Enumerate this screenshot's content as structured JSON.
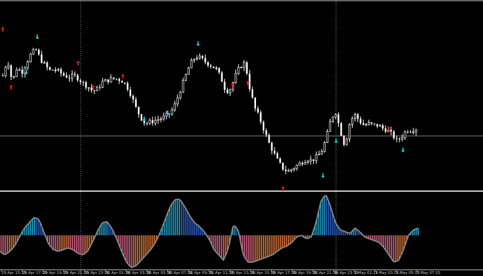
{
  "chart_data": {
    "type": "candlestick",
    "colors": {
      "background": "#000000",
      "candle_up": "#ffffff",
      "candle_down": "#ffffff",
      "wick": "#ffffff",
      "separator": "#c8c8c8",
      "grid_dotted": "#9a9a9a",
      "hline": "#808080",
      "buy_arrow": "#00e5ee",
      "sell_arrow": "#ff1a1a",
      "hist_pos": "#1ea7d6",
      "hist_pos_alt": "#2f63c8",
      "hist_neg": "#d9668a",
      "hist_neg_alt": "#e07a3a",
      "osc_line": "#8a8a8a"
    },
    "price_trace": [
      0.7,
      0.8,
      0.66,
      0.75,
      0.72,
      0.78,
      0.84,
      0.86,
      0.8,
      0.76,
      0.73,
      0.74,
      0.72,
      0.7,
      0.69,
      0.7,
      0.68,
      0.65,
      0.63,
      0.6,
      0.62,
      0.66,
      0.67,
      0.68,
      0.68,
      0.67,
      0.64,
      0.58,
      0.5,
      0.44,
      0.4,
      0.41,
      0.42,
      0.43,
      0.44,
      0.46,
      0.5,
      0.58,
      0.66,
      0.74,
      0.8,
      0.82,
      0.8,
      0.78,
      0.76,
      0.74,
      0.68,
      0.6,
      0.62,
      0.7,
      0.76,
      0.78,
      0.62,
      0.5,
      0.44,
      0.36,
      0.28,
      0.22,
      0.16,
      0.12,
      0.1,
      0.12,
      0.14,
      0.16,
      0.18,
      0.17,
      0.19,
      0.22,
      0.3,
      0.42,
      0.48,
      0.36,
      0.26,
      0.4,
      0.46,
      0.42,
      0.39,
      0.4,
      0.39,
      0.39,
      0.37,
      0.36,
      0.33,
      0.29,
      0.32,
      0.36,
      0.36,
      0.37
    ],
    "buy_signals": [
      [
        0.07,
        0.77
      ],
      [
        0.12,
        0.92
      ],
      [
        0.5,
        0.83
      ],
      [
        0.79,
        0.6
      ],
      [
        1.02,
        0.28
      ],
      [
        1.08,
        0.53
      ],
      [
        1.11,
        0.52
      ],
      [
        1.18,
        0.35
      ]
    ],
    "sell_signals": [
      [
        0.01,
        0.97
      ],
      [
        0.02,
        0.6
      ],
      [
        0.18,
        0.7
      ],
      [
        0.21,
        0.56
      ],
      [
        0.36,
        0.89
      ],
      [
        0.28,
        0.6
      ],
      [
        0.25,
        0.54
      ],
      [
        0.69,
        0.58
      ],
      [
        1.16,
        0.37
      ],
      [
        0.78,
        0.57
      ],
      [
        0.45,
        0.36
      ],
      [
        0.84,
        0.06
      ],
      [
        0.42,
        0.42
      ],
      [
        0.44,
        0.36
      ],
      [
        0.17,
        0.42
      ]
    ],
    "oscillator": [
      -0.45,
      -0.55,
      -0.45,
      -0.3,
      -0.05,
      0.2,
      0.35,
      0.5,
      0.45,
      0.1,
      -0.25,
      -0.4,
      -0.45,
      -0.4,
      -0.35,
      -0.4,
      -0.5,
      -0.55,
      -0.45,
      -0.2,
      0.1,
      0.35,
      0.38,
      0.2,
      -0.1,
      -0.45,
      -0.75,
      -0.9,
      -0.85,
      -0.7,
      -0.55,
      -0.4,
      -0.2,
      0.1,
      0.45,
      0.8,
      1.0,
      1.0,
      0.8,
      0.55,
      0.35,
      0.25,
      0.1,
      -0.1,
      -0.4,
      -0.55,
      -0.7,
      -0.35,
      0.3,
      0.15,
      -0.55,
      -0.75,
      -0.75,
      -0.7,
      -0.65,
      -0.6,
      -0.55,
      -0.45,
      -0.35,
      -0.3,
      -0.2,
      -0.05,
      0.0,
      -0.1,
      -0.05,
      0.35,
      0.95,
      1.15,
      0.8,
      0.35,
      0.15,
      0.1,
      0.05,
      0.2,
      0.1,
      -0.05,
      -0.1,
      -0.15,
      -0.2,
      -0.35,
      -0.55,
      -0.75,
      -0.7,
      -0.4,
      0.0,
      0.15,
      0.2
    ],
    "x_tick_labels": [
      "29 Apr 15:15",
      "29 Apr 17:15",
      "29 Apr 19:15",
      "29 Apr 21:15",
      "29 Apr 23:15",
      "30 Apr 01:15",
      "30 Apr 03:15",
      "30 Apr 05:15",
      "30 Apr 07:15",
      "30 Apr 09:15",
      "30 Apr 11:15",
      "30 Apr 13:15",
      "30 Apr 15:15",
      "30 Apr 17:15",
      "30 Apr 19:15",
      "30 Apr 21:15",
      "30 Apr 23:15",
      "1 May 01:15",
      "1 May 03:15",
      "1 May 05:15",
      "1 May 07:15"
    ],
    "grid": true,
    "legend": "none"
  }
}
